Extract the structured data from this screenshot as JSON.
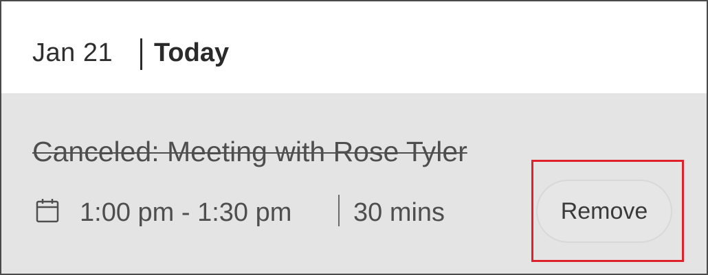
{
  "header": {
    "date": "Jan 21",
    "today_label": "Today"
  },
  "event": {
    "title": "Canceled: Meeting with Rose Tyler",
    "time_range": "1:00 pm - 1:30 pm",
    "duration": "30 mins",
    "icon": "calendar-icon",
    "status": "canceled"
  },
  "actions": {
    "remove_label": "Remove"
  },
  "colors": {
    "card_background": "#e4e4e4",
    "highlight": "#e0202a",
    "text": "#4e4e4e"
  }
}
